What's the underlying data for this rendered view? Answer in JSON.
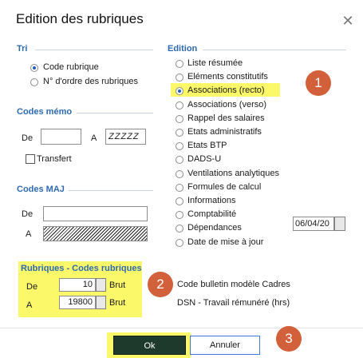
{
  "dialog": {
    "title": "Edition des rubriques",
    "close_icon": "close-icon"
  },
  "tri": {
    "header": "Tri",
    "options": [
      "Code rubrique",
      "N° d'ordre des rubriques"
    ],
    "selected": 0
  },
  "codes_memo": {
    "header": "Codes mémo",
    "de_label": "De",
    "a_label": "A",
    "de_value": "",
    "a_value": "ZZZZZ",
    "transfert_label": "Transfert",
    "transfert_checked": false
  },
  "codes_maj": {
    "header": "Codes MAJ",
    "de_label": "De",
    "a_label": "A",
    "de_value": "",
    "a_value": ""
  },
  "rubriques": {
    "header": "Rubriques - Codes rubriques",
    "de_label": "De",
    "a_label": "A",
    "de_value": "10",
    "a_value": "19800",
    "unit_label": "Brut"
  },
  "edition": {
    "header": "Edition",
    "options": [
      "Liste résumée",
      "Eléments constitutifs",
      "Associations (recto)",
      "Associations (verso)",
      "Rappel des salaires",
      "Etats administratifs",
      "Etats BTP",
      "DADS-U",
      "Ventilations analytiques",
      "Formules de calcul",
      "Informations",
      "Comptabilité",
      "Dépendances",
      "Date de mise à jour"
    ],
    "selected": 2,
    "date_value": "06/04/20"
  },
  "info": {
    "line1": "Code bulletin modèle Cadres",
    "line2": "DSN - Travail rémunéré (hrs)"
  },
  "buttons": {
    "ok": "Ok",
    "cancel": "Annuler"
  },
  "badges": [
    "1",
    "2",
    "3"
  ],
  "colors": {
    "highlight": "#fbf96a",
    "badge": "#d2603a",
    "group_header": "#2e6ab0",
    "ok_button": "#1d3a2c"
  }
}
